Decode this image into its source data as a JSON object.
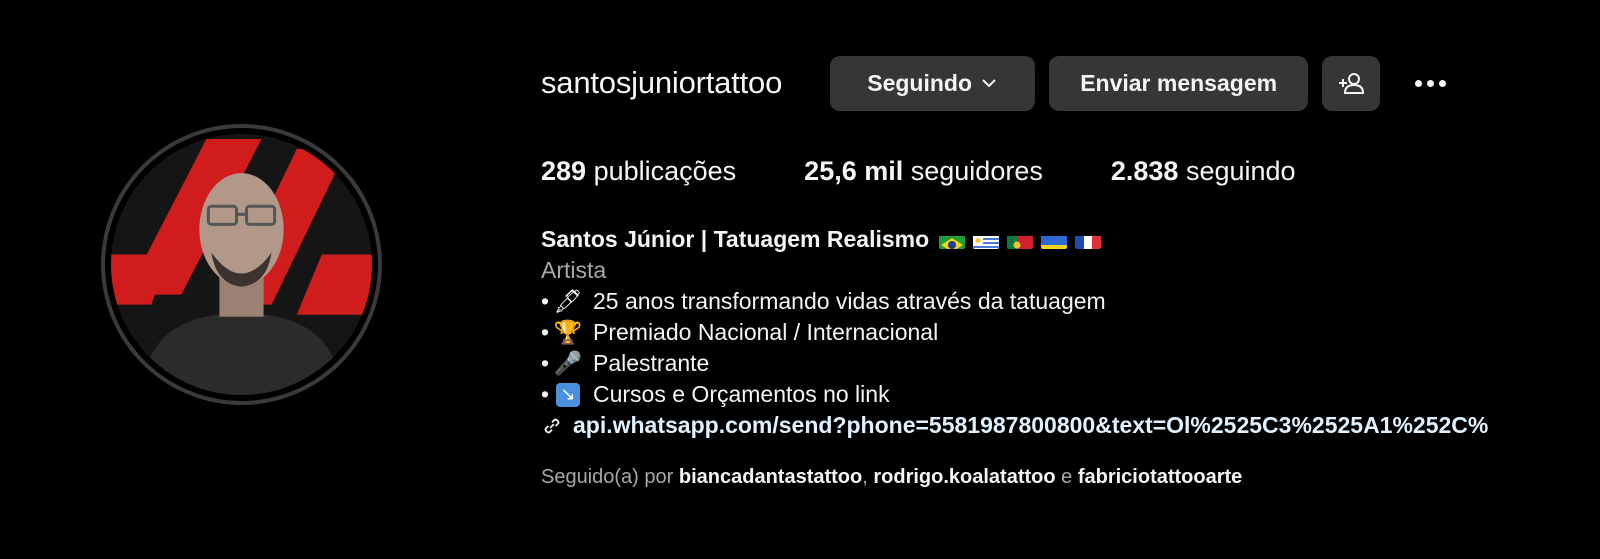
{
  "profile": {
    "username": "santosjuniortattoo",
    "following_button": "Seguindo",
    "message_button": "Enviar mensagem"
  },
  "stats": {
    "posts_count": "289",
    "posts_label": "publicações",
    "followers_count": "25,6 mil",
    "followers_label": "seguidores",
    "following_count": "2.838",
    "following_label": "seguindo"
  },
  "bio": {
    "full_name": "Santos Júnior | Tatuagem Realismo",
    "flags": [
      "brazil-flag",
      "uruguay-flag",
      "portugal-flag",
      "ukraine-flag",
      "france-flag"
    ],
    "category": "Artista",
    "lines": [
      {
        "bullet": "•",
        "emoji": "🖋",
        "text": "25 anos transformando vidas através da tatuagem"
      },
      {
        "bullet": "•",
        "emoji": "🏆",
        "text": "Premiado Nacional / Internacional"
      },
      {
        "bullet": "•",
        "emoji": "🎤",
        "text": "Palestrante"
      },
      {
        "bullet": "•",
        "emoji": "↘",
        "text": "Cursos e Orçamentos no link"
      }
    ],
    "link": "api.whatsapp.com/send?phone=5581987800800&text=Ol%2525C3%2525A1%252C%"
  },
  "followed_by": {
    "prefix": "Seguido(a) por",
    "user1": "biancadantastattoo",
    "separator": ",",
    "user2": "rodrigo.koalatattoo",
    "conjunction": "e",
    "user3": "fabriciotattooarte"
  },
  "colors": {
    "background": "#000000",
    "button_bg": "#363636",
    "secondary_text": "#a8a8a8",
    "avatar_red": "#d01c1c"
  }
}
